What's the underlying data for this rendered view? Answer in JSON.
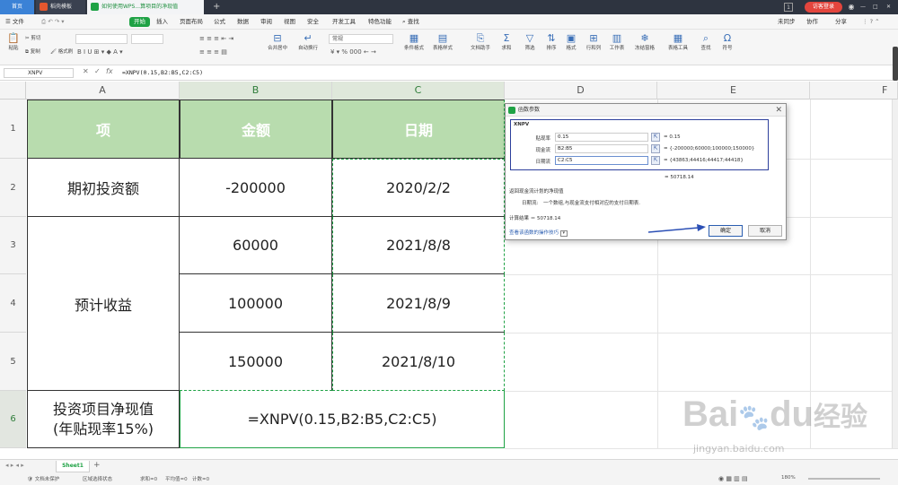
{
  "titlebar": {
    "tabs": [
      {
        "label": "首页"
      },
      {
        "label": "稻壳模板"
      },
      {
        "label": "如何使用WPS...算项目的净现值"
      }
    ],
    "new_tab": "+",
    "badge": "1",
    "login_label": "访客登录",
    "window_controls": [
      "—",
      "□",
      "✕"
    ]
  },
  "menubar": {
    "file": "文件",
    "items": [
      "开始",
      "插入",
      "页面布局",
      "公式",
      "数据",
      "审阅",
      "视图",
      "安全",
      "开发工具",
      "特色功能"
    ],
    "search": "查找",
    "right": [
      "未同步",
      "协作",
      "分享"
    ]
  },
  "ribbon": {
    "paste": "粘贴",
    "cut": "剪切",
    "copy": "复制",
    "format_painter": "格式刷",
    "merge": "合并居中",
    "wrap": "自动换行",
    "number_format": "常规",
    "conditional": "条件格式",
    "table_style": "表格样式",
    "doc_helper": "文档助手",
    "sum": "求和",
    "filter": "筛选",
    "sort": "排序",
    "format": "格式",
    "rowcol": "行和列",
    "worksheet": "工作表",
    "freeze": "冻结窗格",
    "table_tools": "表格工具",
    "find": "查找",
    "symbol": "符号"
  },
  "formula_bar": {
    "name_box": "XNPV",
    "cancel": "✕",
    "confirm": "✓",
    "fx": "fx",
    "formula": "=XNPV(0.15,B2:B5,C2:C5)"
  },
  "columns": [
    "A",
    "B",
    "C",
    "D",
    "E",
    "F"
  ],
  "rows": [
    "1",
    "2",
    "3",
    "4",
    "5",
    "6"
  ],
  "sheet": {
    "header": {
      "a": "项",
      "b": "金额",
      "c": "日期"
    },
    "r2": {
      "a": "期初投资额",
      "b": "-200000",
      "c": "2020/2/2"
    },
    "r3": {
      "b": "60000",
      "c": "2021/8/8"
    },
    "r4": {
      "a": "预计收益",
      "b": "100000",
      "c": "2021/8/9"
    },
    "r5": {
      "b": "150000",
      "c": "2021/8/10"
    },
    "r6": {
      "a_line1": "投资项目净现值",
      "a_line2": "(年贴现率15%)",
      "bc": "=XNPV(0.15,B2:B5,C2:C5)"
    },
    "header_fill": "#b8dcae",
    "selection_color": "#1fa245"
  },
  "dialog": {
    "title": "函数参数",
    "close": "✕",
    "func_name": "XNPV",
    "args": [
      {
        "label": "贴现率",
        "input": "0.15",
        "result": "= 0.15"
      },
      {
        "label": "现金流",
        "input": "B2:B5",
        "result": "= {-200000;60000;100000;150000}"
      },
      {
        "label": "日期流",
        "input": "C2:C5",
        "result": "= {43863;44416;44417;44418}"
      }
    ],
    "total": "= 50718.14",
    "description": "返回现金流计划的净现值",
    "arg_help_label": "日期流:",
    "arg_help": "一个数组,与现金流支付相对应的支付日期表.",
    "calc_result": "计算结果 ＝ 50718.14",
    "help_link": "查看该函数的操作技巧",
    "ok": "确定",
    "cancel": "取消"
  },
  "status": {
    "sheet_tab": "Sheet1",
    "add_sheet": "+",
    "protect": "文档未保护",
    "select_state": "区域选择状态",
    "sum": "求和=0",
    "avg": "平均值=0",
    "count": "计数=0",
    "zoom": "180%"
  },
  "watermark": {
    "brand": "Bai",
    "brand2": "du",
    "cn": "经验",
    "url": "jingyan.baidu.com"
  }
}
